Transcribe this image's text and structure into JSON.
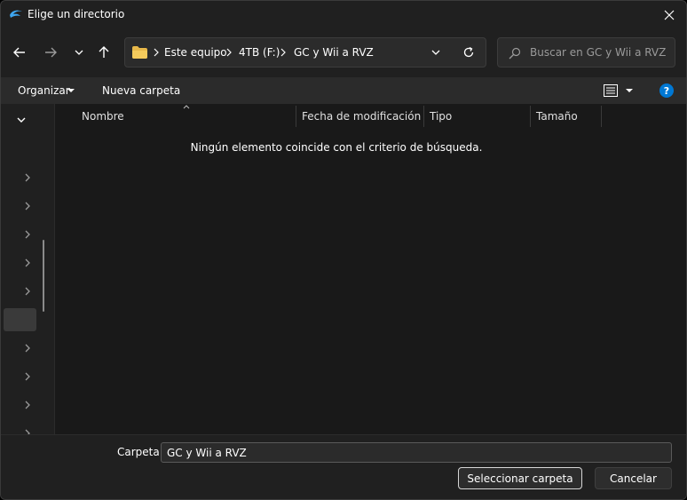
{
  "window": {
    "title": "Elige un directorio"
  },
  "address": {
    "breadcrumbs": [
      "Este equipo",
      "4TB (F:)",
      "GC y Wii a RVZ"
    ]
  },
  "search": {
    "placeholder": "Buscar en GC y Wii a RVZ"
  },
  "toolbar": {
    "organize_label": "Organizar",
    "new_folder_label": "Nueva carpeta"
  },
  "columns": [
    "Nombre",
    "Fecha de modificación",
    "Tipo",
    "Tamaño"
  ],
  "empty_message": "Ningún elemento coincide con el criterio de búsqueda.",
  "footer": {
    "folder_label": "Carpeta:",
    "folder_value": "GC y Wii a RVZ",
    "select_label": "Seleccionar carpeta",
    "cancel_label": "Cancelar"
  },
  "colors": {
    "accent": "#0078d4",
    "background": "#202020",
    "content": "#191919"
  },
  "icons": [
    "dolphin-app-icon",
    "close-icon",
    "back-arrow-icon",
    "forward-arrow-icon",
    "chevron-down-icon",
    "up-arrow-icon",
    "folder-icon",
    "refresh-icon",
    "search-icon",
    "view-options-icon",
    "help-icon",
    "chevron-right-icon"
  ]
}
